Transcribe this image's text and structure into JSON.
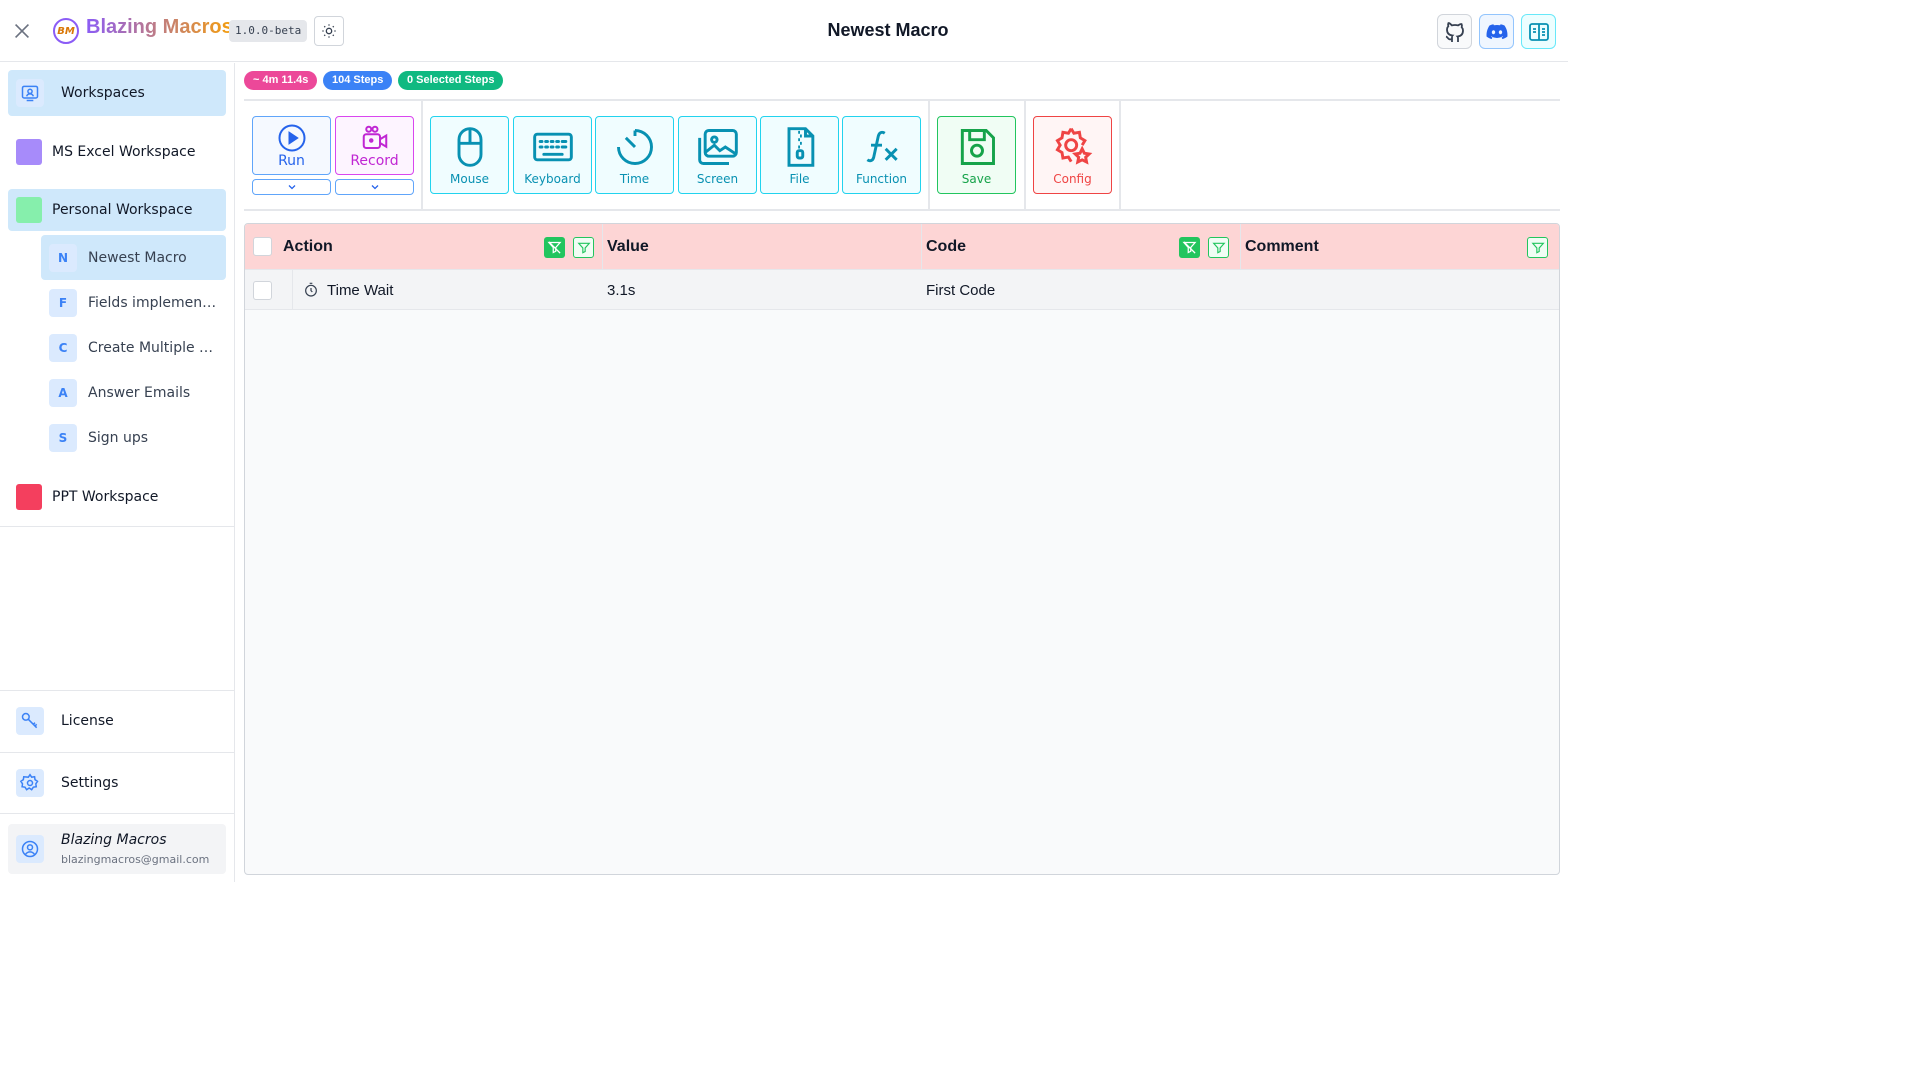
{
  "app": {
    "brand": "Blazing Macros",
    "logo_text": "BM",
    "version": "1.0.0-beta",
    "title": "Newest Macro"
  },
  "sidebar": {
    "workspaces_label": "Workspaces",
    "workspaces": [
      {
        "label": "MS Excel Workspace",
        "color": "#a78bfa"
      },
      {
        "label": "Personal Workspace",
        "color": "#86efac"
      },
      {
        "label": "PPT Workspace",
        "color": "#f43f5e"
      }
    ],
    "macros": [
      {
        "letter": "N",
        "label": "Newest Macro"
      },
      {
        "letter": "F",
        "label": "Fields implementor"
      },
      {
        "letter": "C",
        "label": "Create Multiple Sh..."
      },
      {
        "letter": "A",
        "label": "Answer Emails"
      },
      {
        "letter": "S",
        "label": "Sign ups"
      }
    ],
    "license_label": "License",
    "settings_label": "Settings",
    "user": {
      "name": "Blazing Macros",
      "email": "blazingmacros@gmail.com"
    }
  },
  "badges": {
    "duration": "~ 4m 11.4s",
    "steps": "104 Steps",
    "selected": "0 Selected Steps"
  },
  "toolbar": {
    "run": "Run",
    "record": "Record",
    "mouse": "Mouse",
    "keyboard": "Keyboard",
    "time": "Time",
    "screen": "Screen",
    "file": "File",
    "function": "Function",
    "save": "Save",
    "config": "Config"
  },
  "table": {
    "headers": {
      "action": "Action",
      "value": "Value",
      "code": "Code",
      "comment": "Comment"
    },
    "rows": [
      {
        "action": "Time Wait",
        "value": "3.1s",
        "code": "First Code",
        "comment": ""
      }
    ]
  },
  "colors": {
    "badge_duration": "#ec4899",
    "badge_steps": "#3b82f6",
    "badge_selected": "#10b981",
    "table_header": "#fdd5d5",
    "active_item": "#cfe8fb"
  }
}
